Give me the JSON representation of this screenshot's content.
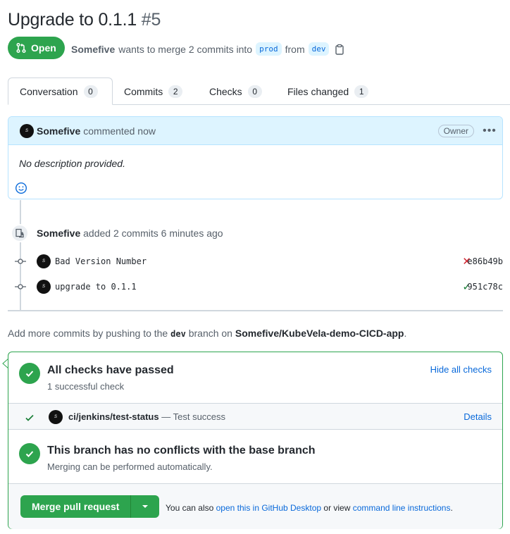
{
  "pr": {
    "title": "Upgrade to 0.1.1",
    "number": "#5",
    "state": "Open",
    "author": "Somefive",
    "meta_text": "wants to merge 2 commits into",
    "base_branch": "prod",
    "from_text": "from",
    "head_branch": "dev"
  },
  "tabs": [
    {
      "label": "Conversation",
      "count": "0"
    },
    {
      "label": "Commits",
      "count": "2"
    },
    {
      "label": "Checks",
      "count": "0"
    },
    {
      "label": "Files changed",
      "count": "1"
    }
  ],
  "comment": {
    "author": "Somefive",
    "time": "commented now",
    "role": "Owner",
    "body": "No description provided."
  },
  "timeline": {
    "author": "Somefive",
    "action": "added 2 commits 6 minutes ago",
    "commits": [
      {
        "message": "Bad Version Number",
        "status": "✕",
        "sha": "e86b49b",
        "status_color": "#cf222e"
      },
      {
        "message": "upgrade to 0.1.1",
        "status": "✓",
        "sha": "951c78c",
        "status_color": "#1a7f37"
      }
    ]
  },
  "hint": {
    "prefix": "Add more commits by pushing to the",
    "branch": "dev",
    "middle": "branch on",
    "repo": "Somefive/KubeVela-demo-CICD-app",
    "suffix": "."
  },
  "merge": {
    "checks_title": "All checks have passed",
    "checks_sub": "1 successful check",
    "hide_checks": "Hide all checks",
    "check_name": "ci/jenkins/test-status",
    "check_desc": "— Test success",
    "details": "Details",
    "conflicts_title": "This branch has no conflicts with the base branch",
    "conflicts_sub": "Merging can be performed automatically.",
    "merge_button": "Merge pull request",
    "also_prefix": "You can also",
    "desktop_link": "open this in GitHub Desktop",
    "or_view": "or view",
    "cli_link": "command line instructions",
    "period": "."
  },
  "colors": {
    "success": "#2da44e",
    "link": "#0969da",
    "fail": "#cf222e"
  }
}
